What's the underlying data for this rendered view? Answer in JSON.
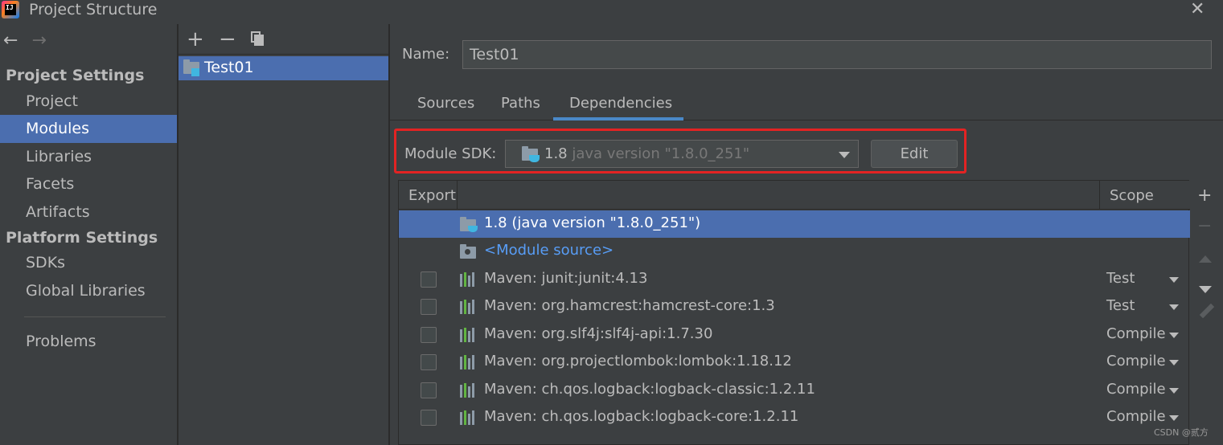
{
  "window": {
    "title": "Project Structure",
    "close": "✕"
  },
  "nav": {
    "back": "←",
    "forward": "→"
  },
  "sidebar": {
    "project_settings_title": "Project Settings",
    "project_items": [
      {
        "label": "Project"
      },
      {
        "label": "Modules"
      },
      {
        "label": "Libraries"
      },
      {
        "label": "Facets"
      },
      {
        "label": "Artifacts"
      }
    ],
    "platform_settings_title": "Platform Settings",
    "platform_items": [
      {
        "label": "SDKs"
      },
      {
        "label": "Global Libraries"
      }
    ],
    "problems_label": "Problems",
    "selected": "Modules"
  },
  "modules_toolbar": {
    "add": "+",
    "remove": "−"
  },
  "modules": [
    {
      "name": "Test01"
    }
  ],
  "module_editor": {
    "name_label": "Name:",
    "name_value": "Test01",
    "tabs": [
      {
        "label": "Sources"
      },
      {
        "label": "Paths"
      },
      {
        "label": "Dependencies"
      }
    ],
    "active_tab": "Dependencies",
    "sdk_label": "Module SDK:",
    "sdk_name": "1.8",
    "sdk_detail": "java version \"1.8.0_251\"",
    "edit_label": "Edit"
  },
  "dependencies": {
    "columns": {
      "export": "Export",
      "scope": "Scope"
    },
    "rows": [
      {
        "name": "1.8 (java version \"1.8.0_251\")",
        "type": "sdk",
        "scope": ""
      },
      {
        "name": "<Module source>",
        "type": "source",
        "scope": ""
      },
      {
        "name": "Maven: junit:junit:4.13",
        "type": "maven",
        "scope": "Test"
      },
      {
        "name": "Maven: org.hamcrest:hamcrest-core:1.3",
        "type": "maven",
        "scope": "Test"
      },
      {
        "name": "Maven: org.slf4j:slf4j-api:1.7.30",
        "type": "maven",
        "scope": "Compile"
      },
      {
        "name": "Maven: org.projectlombok:lombok:1.18.12",
        "type": "maven",
        "scope": "Compile"
      },
      {
        "name": "Maven: ch.qos.logback:logback-classic:1.2.11",
        "type": "maven",
        "scope": "Compile"
      },
      {
        "name": "Maven: ch.qos.logback:logback-core:1.2.11",
        "type": "maven",
        "scope": "Compile"
      }
    ]
  },
  "table_actions": {
    "add": "+",
    "remove": "−"
  },
  "colors": {
    "selection": "#4b6eaf",
    "highlight_border": "#e32323",
    "link": "#589df6",
    "background": "#3c3f41"
  },
  "watermark": "CSDN @贰方"
}
